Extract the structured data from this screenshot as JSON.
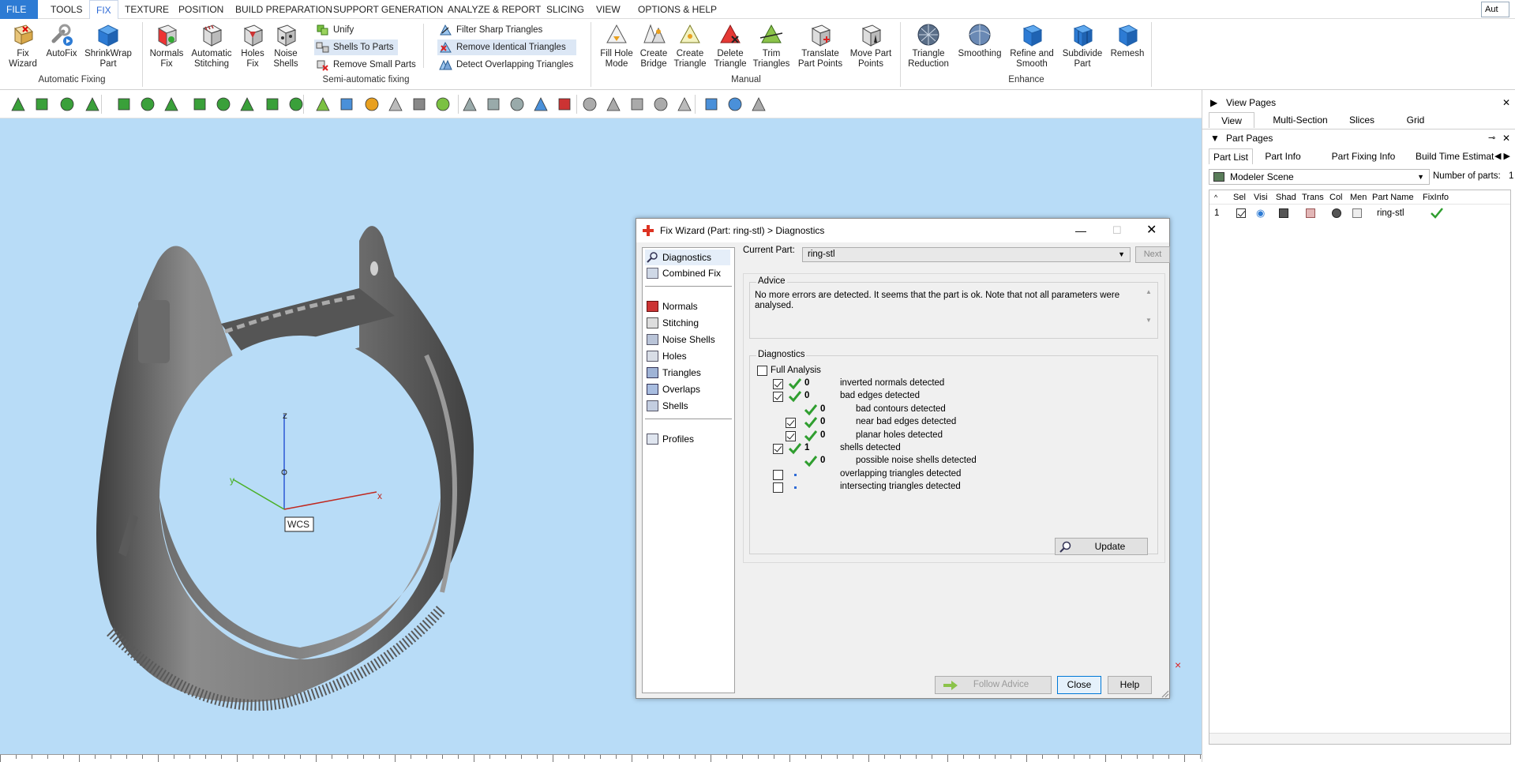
{
  "menu": {
    "items": [
      "FILE",
      "TOOLS",
      "FIX",
      "TEXTURE",
      "POSITION",
      "BUILD PREPARATION",
      "SUPPORT GENERATION",
      "ANALYZE & REPORT",
      "SLICING",
      "VIEW",
      "OPTIONS & HELP"
    ],
    "active": "FIX",
    "right_text": "Aut"
  },
  "ribbon": {
    "automatic_fixing": {
      "group_label": "Automatic Fixing",
      "buttons": [
        {
          "line1": "Fix",
          "line2": "Wizard"
        },
        {
          "line1": "AutoFix",
          "line2": ""
        },
        {
          "line1": "ShrinkWrap",
          "line2": "Part"
        }
      ]
    },
    "semi_automatic": {
      "group_label": "Semi-automatic fixing",
      "big_buttons": [
        {
          "line1": "Normals",
          "line2": "Fix"
        },
        {
          "line1": "Automatic",
          "line2": "Stitching"
        },
        {
          "line1": "Holes",
          "line2": "Fix"
        },
        {
          "line1": "Noise",
          "line2": "Shells"
        }
      ],
      "small_buttons": [
        "Unify",
        "Shells To Parts",
        "Remove Small Parts",
        "Filter Sharp Triangles",
        "Remove Identical Triangles",
        "Detect Overlapping Triangles"
      ]
    },
    "manual": {
      "group_label": "Manual",
      "buttons": [
        {
          "line1": "Fill Hole",
          "line2": "Mode"
        },
        {
          "line1": "Create",
          "line2": "Bridge"
        },
        {
          "line1": "Create",
          "line2": "Triangle"
        },
        {
          "line1": "Delete",
          "line2": "Triangle"
        },
        {
          "line1": "Trim",
          "line2": "Triangles"
        },
        {
          "line1": "Translate",
          "line2": "Part Points"
        },
        {
          "line1": "Move Part",
          "line2": "Points"
        }
      ]
    },
    "enhance": {
      "group_label": "Enhance",
      "buttons": [
        {
          "line1": "Triangle",
          "line2": "Reduction"
        },
        {
          "line1": "Smoothing",
          "line2": ""
        },
        {
          "line1": "Refine and",
          "line2": "Smooth"
        },
        {
          "line1": "Subdivide",
          "line2": "Part"
        },
        {
          "line1": "Remesh",
          "line2": ""
        }
      ]
    }
  },
  "viewport": {
    "axis_z": "z",
    "axis_y": "y",
    "axis_x": "x",
    "wcs_label": "WCS",
    "background": "#b8dcf7"
  },
  "right_panel": {
    "view_pages": {
      "title": "View Pages",
      "tabs": [
        "View",
        "Multi-Section",
        "Slices",
        "Grid"
      ],
      "active": "View"
    },
    "part_pages": {
      "title": "Part Pages",
      "tabs": [
        "Part List",
        "Part Info",
        "Part Fixing Info",
        "Build Time Estimation"
      ],
      "active": "Part List"
    },
    "scene_select": "Modeler Scene",
    "number_of_parts_label": "Number of parts:",
    "number_of_parts": "1",
    "columns": [
      "Sele",
      "Visi",
      "Shad",
      "Trans",
      "Col",
      "Men",
      "Part Name",
      "FixInfo"
    ],
    "rows": [
      {
        "index": "1",
        "name": "ring-stl"
      }
    ]
  },
  "dialog": {
    "title": "Fix Wizard (Part: ring-stl) > Diagnostics",
    "nav": [
      "Diagnostics",
      "Combined Fix",
      "Normals",
      "Stitching",
      "Noise Shells",
      "Holes",
      "Triangles",
      "Overlaps",
      "Shells",
      "Profiles"
    ],
    "nav_active": "Diagnostics",
    "current_part_label": "Current Part:",
    "current_part": "ring-stl",
    "next_label": "Next",
    "advice_legend": "Advice",
    "advice_text": "No more errors are detected. It seems that the part is ok. Note that not all parameters were analysed.",
    "diagnostics_legend": "Diagnostics",
    "full_analysis_label": "Full Analysis",
    "rows": [
      {
        "count": "0",
        "label": "inverted normals detected",
        "checked": true,
        "status": "ok",
        "level": 0
      },
      {
        "count": "0",
        "label": "bad edges detected",
        "checked": true,
        "status": "ok",
        "level": 0
      },
      {
        "count": "0",
        "label": "bad contours detected",
        "checked": false,
        "status": "ok",
        "level": 1
      },
      {
        "count": "0",
        "label": "near bad edges detected",
        "checked": true,
        "status": "ok",
        "level": 1
      },
      {
        "count": "0",
        "label": "planar holes detected",
        "checked": true,
        "status": "ok",
        "level": 1
      },
      {
        "count": "1",
        "label": "shells detected",
        "checked": true,
        "status": "ok",
        "level": 0
      },
      {
        "count": "0",
        "label": "possible noise shells detected",
        "checked": false,
        "status": "ok",
        "level": 1
      },
      {
        "count": "",
        "label": "overlapping triangles detected",
        "checked": false,
        "status": "none",
        "level": 0
      },
      {
        "count": "",
        "label": "intersecting triangles detected",
        "checked": false,
        "status": "none",
        "level": 0
      }
    ],
    "update_label": "Update",
    "follow_advice_label": "Follow Advice",
    "close_label": "Close",
    "help_label": "Help"
  },
  "colors": {
    "accent": "#2d6ad6",
    "ok_green": "#2f9e2f",
    "viewport_bg": "#b8dcf7"
  }
}
